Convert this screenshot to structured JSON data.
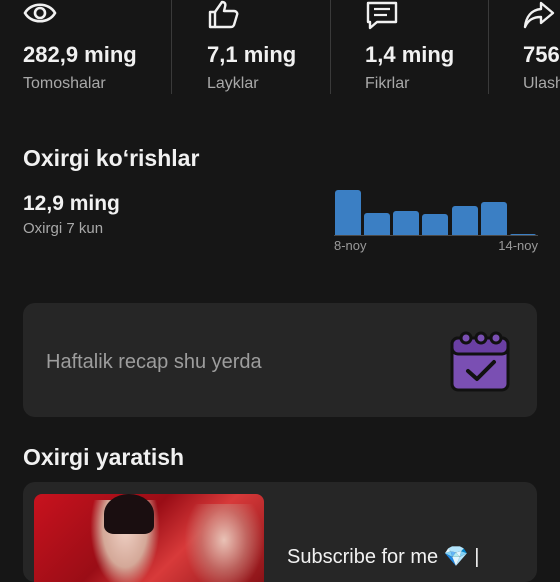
{
  "stats": [
    {
      "icon": "eye-icon",
      "value": "282,9 ming",
      "label": "Tomoshalar"
    },
    {
      "icon": "thumbs-up-icon",
      "value": "7,1 ming",
      "label": "Layklar"
    },
    {
      "icon": "comment-icon",
      "value": "1,4 ming",
      "label": "Fikrlar"
    },
    {
      "icon": "share-icon",
      "value": "756",
      "label": "Ulash"
    }
  ],
  "recent": {
    "title": "Oxirgi ko‘rishlar",
    "value": "12,9 ming",
    "period": "Oxirgi 7 kun"
  },
  "chart_data": {
    "type": "bar",
    "x_start_label": "8-noy",
    "x_end_label": "14-noy",
    "values": [
      1.0,
      0.5,
      0.55,
      0.48,
      0.65,
      0.75,
      0.04
    ],
    "color": "#3b7fc4"
  },
  "recap": {
    "text": "Haftalik recap shu yerda",
    "icon": "calendar-check-icon",
    "icon_color": "#7a4fb3"
  },
  "latest": {
    "title": "Oxirgi yaratish",
    "video_title": "Subscribe for me 💎 |"
  }
}
